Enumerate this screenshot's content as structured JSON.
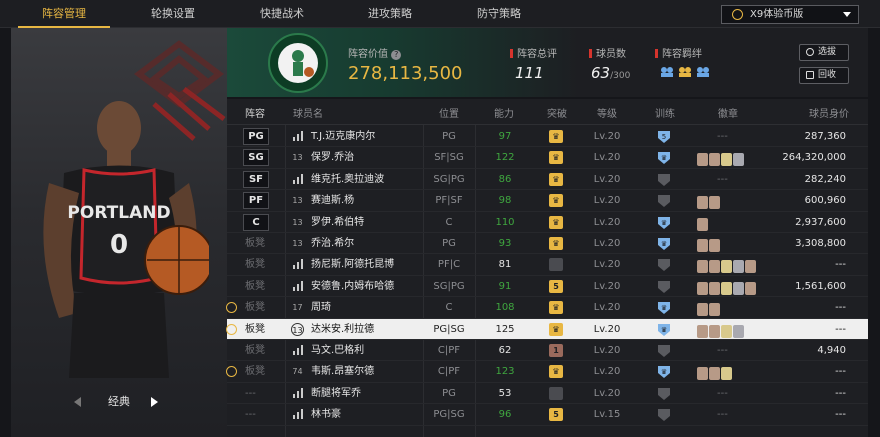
{
  "tabs": [
    "阵容管理",
    "轮换设置",
    "快捷战术",
    "进攻策略",
    "防守策略"
  ],
  "active_tab": 0,
  "dropdown": {
    "label": "X9体验币版"
  },
  "player_card": {
    "nav_label": "经典",
    "jersey_text": "PORTLAND",
    "jersey_number": "0"
  },
  "summary": {
    "value_label": "阵容价值",
    "value": "278,113,500",
    "ovr_label": "阵容总评",
    "ovr": "111",
    "count_label": "球员数",
    "count": "63",
    "count_max": "/300",
    "chem_label": "阵容羁绊",
    "select_button": "选拔",
    "recycle_button": "回收"
  },
  "columns": {
    "lineup": "阵容",
    "name": "球员名",
    "position": "位置",
    "ovr": "能力",
    "breakthrough": "突破",
    "level": "等级",
    "training": "训练",
    "badges": "徽章",
    "price": "球员身价"
  },
  "rows": [
    {
      "slot": "PG",
      "slot_type": "starter",
      "num": "",
      "name": "T.J.迈克康内尔",
      "pos": "PG",
      "ovr": "97",
      "ovr_color": "#3fa63f",
      "break": "crown-gold",
      "level": "Lv.20",
      "train": "blue-5",
      "badges": 0,
      "price": "287,360",
      "clock": false,
      "selected": false
    },
    {
      "slot": "SG",
      "slot_type": "starter",
      "num": "13",
      "name": "保罗.乔治",
      "pos": "SF|SG",
      "ovr": "122",
      "ovr_color": "#3fa63f",
      "break": "crown-gold",
      "level": "Lv.20",
      "train": "blue-crown",
      "badges": 4,
      "price": "264,320,000",
      "clock": false,
      "selected": false
    },
    {
      "slot": "SF",
      "slot_type": "starter",
      "num": "",
      "name": "维克托.奥拉迪波",
      "pos": "SG|PG",
      "ovr": "86",
      "ovr_color": "#3fa63f",
      "break": "crown-gold",
      "level": "Lv.20",
      "train": "gray",
      "badges": 0,
      "price": "282,240",
      "clock": false,
      "selected": false
    },
    {
      "slot": "PF",
      "slot_type": "starter",
      "num": "13",
      "name": "赛迪斯.杨",
      "pos": "PF|SF",
      "ovr": "98",
      "ovr_color": "#3fa63f",
      "break": "crown-gold",
      "level": "Lv.20",
      "train": "gray",
      "badges": 2,
      "price": "600,960",
      "clock": false,
      "selected": false
    },
    {
      "slot": "C",
      "slot_type": "starter",
      "num": "13",
      "name": "罗伊.希伯特",
      "pos": "C",
      "ovr": "110",
      "ovr_color": "#3fa63f",
      "break": "crown-gold",
      "level": "Lv.20",
      "train": "blue-crown",
      "badges": 1,
      "price": "2,937,600",
      "clock": false,
      "selected": false
    },
    {
      "slot": "板凳",
      "slot_type": "bench",
      "num": "13",
      "name": "乔治.希尔",
      "pos": "PG",
      "ovr": "93",
      "ovr_color": "#3fa63f",
      "break": "crown-gold",
      "level": "Lv.20",
      "train": "blue-crown",
      "badges": 2,
      "price": "3,308,800",
      "clock": false,
      "selected": false
    },
    {
      "slot": "板凳",
      "slot_type": "bench",
      "num": "",
      "name": "扬尼斯.阿德托昆博",
      "pos": "PF|C",
      "ovr": "81",
      "ovr_color": "#e6e6e6",
      "break": "gray",
      "level": "Lv.20",
      "train": "gray",
      "badges": 5,
      "price": "---",
      "clock": false,
      "selected": false
    },
    {
      "slot": "板凳",
      "slot_type": "bench",
      "num": "",
      "name": "安德鲁.内姆布哈德",
      "pos": "SG|PG",
      "ovr": "91",
      "ovr_color": "#3fa63f",
      "break": "gold-5",
      "level": "Lv.20",
      "train": "gray",
      "badges": 5,
      "price": "1,561,600",
      "clock": false,
      "selected": false
    },
    {
      "slot": "板凳",
      "slot_type": "bench",
      "num": "17",
      "name": "周琦",
      "pos": "C",
      "ovr": "108",
      "ovr_color": "#3fa63f",
      "break": "crown-gold",
      "level": "Lv.20",
      "train": "blue-crown",
      "badges": 2,
      "price": "---",
      "clock": true,
      "selected": false
    },
    {
      "slot": "板凳",
      "slot_type": "bench",
      "num": "13",
      "name": "达米安.利拉德",
      "pos": "PG|SG",
      "ovr": "125",
      "ovr_color": "#222222",
      "break": "crown-gold",
      "level": "Lv.20",
      "train": "blue-crown",
      "badges": 4,
      "price": "---",
      "clock": true,
      "selected": true
    },
    {
      "slot": "板凳",
      "slot_type": "bench",
      "num": "",
      "name": "马文.巴格利",
      "pos": "C|PF",
      "ovr": "62",
      "ovr_color": "#e6e6e6",
      "break": "bronze-1",
      "level": "Lv.20",
      "train": "gray",
      "badges": 0,
      "price": "4,940",
      "clock": false,
      "selected": false
    },
    {
      "slot": "板凳",
      "slot_type": "bench",
      "num": "74",
      "name": "韦斯.昂塞尔德",
      "pos": "C|PF",
      "ovr": "123",
      "ovr_color": "#3fa63f",
      "break": "crown-gold",
      "level": "Lv.20",
      "train": "blue-crown",
      "badges": 3,
      "price": "---",
      "clock": true,
      "selected": false
    },
    {
      "slot": "---",
      "slot_type": "none",
      "num": "",
      "name": "断腿将军乔",
      "pos": "PG",
      "ovr": "53",
      "ovr_color": "#e6e6e6",
      "break": "gray",
      "level": "Lv.20",
      "train": "gray",
      "badges": 0,
      "price": "---",
      "clock": false,
      "selected": false
    },
    {
      "slot": "---",
      "slot_type": "none",
      "num": "",
      "name": "林书豪",
      "pos": "PG|SG",
      "ovr": "96",
      "ovr_color": "#3fa63f",
      "break": "gold-5",
      "level": "Lv.15",
      "train": "gray",
      "badges": 0,
      "price": "---",
      "clock": false,
      "selected": false
    }
  ],
  "colors": {
    "accent": "#e8b743",
    "green": "#3fa63f",
    "red_mark": "#d6342d",
    "selected_row": "#efefef"
  }
}
